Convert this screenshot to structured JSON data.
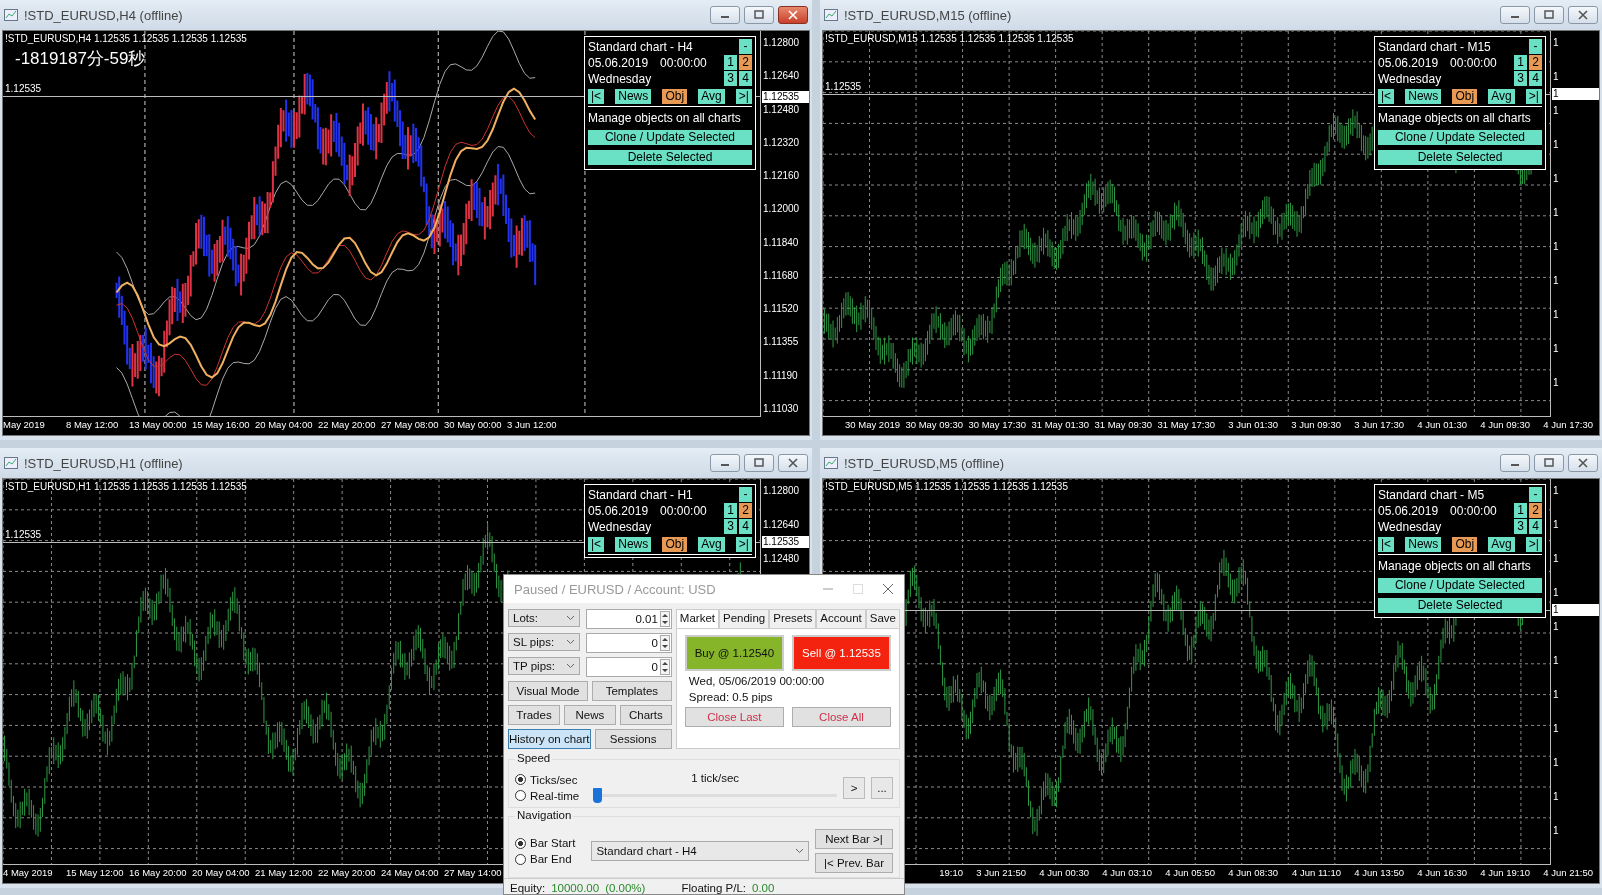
{
  "windows": [
    {
      "title": "!STD_EURUSD,H4 (offline)",
      "active": true,
      "kind": "candles",
      "symbol_line": "!STD_EURUSD,H4  1.12535 1.12535 1.12535 1.12535",
      "overlay_text": "-1819187分-59秒",
      "price_line_label": "1.12535",
      "y_axis_labels": [
        {
          "text": "1.12800",
          "current": false
        },
        {
          "text": "1.12640",
          "current": false
        },
        {
          "text": "1.12535",
          "current": true
        },
        {
          "text": "1.12480",
          "current": false
        },
        {
          "text": "1.12320",
          "current": false
        },
        {
          "text": "1.12160",
          "current": false
        },
        {
          "text": "1.12000",
          "current": false
        },
        {
          "text": "1.11840",
          "current": false
        },
        {
          "text": "1.11680",
          "current": false
        },
        {
          "text": "1.11520",
          "current": false
        },
        {
          "text": "1.11355",
          "current": false
        },
        {
          "text": "1.11190",
          "current": false
        },
        {
          "text": "1.11030",
          "current": false
        }
      ],
      "x_axis_labels": [
        "May 2019",
        "8 May 12:00",
        "13 May 00:00",
        "15 May 16:00",
        "20 May 04:00",
        "22 May 20:00",
        "27 May 08:00",
        "30 May 00:00",
        "3 Jun 12:00"
      ],
      "panel": {
        "title": "Standard chart - H4",
        "date": "05.06.2019",
        "time": "00:00:00",
        "weekday": "Wednesday",
        "collapse": "-",
        "numbers": [
          {
            "label": "1",
            "selected": false
          },
          {
            "label": "2",
            "selected": true
          },
          {
            "label": "3",
            "selected": false
          },
          {
            "label": "4",
            "selected": false
          }
        ],
        "nav": [
          {
            "label": "|<",
            "selected": false
          },
          {
            "label": "News",
            "selected": false
          },
          {
            "label": "Obj",
            "selected": true
          },
          {
            "label": "Avg",
            "selected": false
          },
          {
            "label": ">|",
            "selected": false
          }
        ],
        "manage_title": "Manage objects on all charts",
        "actions": [
          "Clone / Update Selected",
          "Delete Selected"
        ]
      }
    },
    {
      "title": "!STD_EURUSD,M15 (offline)",
      "active": false,
      "kind": "bars",
      "symbol_line": "!STD_EURUSD,M15  1.12535 1.12535 1.12535 1.12535",
      "price_line_label": "1.12535",
      "y_axis_labels": [
        {
          "text": "1",
          "current": false
        },
        {
          "text": "1",
          "current": false
        },
        {
          "text": "1",
          "current": true
        },
        {
          "text": "1",
          "current": false
        },
        {
          "text": "1",
          "current": false
        },
        {
          "text": "1",
          "current": false
        },
        {
          "text": "1",
          "current": false
        },
        {
          "text": "1",
          "current": false
        },
        {
          "text": "1",
          "current": false
        },
        {
          "text": "1",
          "current": false
        },
        {
          "text": "1",
          "current": false
        },
        {
          "text": "1",
          "current": false
        }
      ],
      "x_axis_labels": [
        "30 May 2019",
        "30 May 09:30",
        "30 May 17:30",
        "31 May 01:30",
        "31 May 09:30",
        "31 May 17:30",
        "3 Jun 01:30",
        "3 Jun 09:30",
        "3 Jun 17:30",
        "4 Jun 01:30",
        "4 Jun 09:30",
        "4 Jun 17:30"
      ],
      "panel": {
        "title": "Standard chart - M15",
        "date": "05.06.2019",
        "time": "00:00:00",
        "weekday": "Wednesday",
        "collapse": "-",
        "numbers": [
          {
            "label": "1",
            "selected": false
          },
          {
            "label": "2",
            "selected": true
          },
          {
            "label": "3",
            "selected": false
          },
          {
            "label": "4",
            "selected": false
          }
        ],
        "nav": [
          {
            "label": "|<",
            "selected": false
          },
          {
            "label": "News",
            "selected": false
          },
          {
            "label": "Obj",
            "selected": true
          },
          {
            "label": "Avg",
            "selected": false
          },
          {
            "label": ">|",
            "selected": false
          }
        ],
        "manage_title": "Manage objects on all charts",
        "actions": [
          "Clone / Update Selected",
          "Delete Selected"
        ]
      }
    },
    {
      "title": "!STD_EURUSD,H1 (offline)",
      "active": false,
      "kind": "bars",
      "symbol_line": "!STD_EURUSD,H1  1.12535 1.12535 1.12535 1.12535",
      "price_line_label": "1.12535",
      "y_axis_labels": [
        {
          "text": "1.12800",
          "current": false
        },
        {
          "text": "1.12640",
          "current": false
        },
        {
          "text": "1.12535",
          "current": true
        },
        {
          "text": "1.12480",
          "current": false
        }
      ],
      "x_axis_labels": [
        "4 May 2019",
        "15 May 12:00",
        "16 May 20:00",
        "20 May 04:00",
        "21 May 12:00",
        "22 May 20:00",
        "24 May 04:00",
        "27 May 14:00"
      ],
      "panel": {
        "title": "Standard chart - H1",
        "date": "05.06.2019",
        "time": "00:00:00",
        "weekday": "Wednesday",
        "collapse": "-",
        "numbers": [
          {
            "label": "1",
            "selected": false
          },
          {
            "label": "2",
            "selected": true
          },
          {
            "label": "3",
            "selected": false
          },
          {
            "label": "4",
            "selected": false
          }
        ],
        "nav": [
          {
            "label": "|<",
            "selected": false
          },
          {
            "label": "News",
            "selected": false
          },
          {
            "label": "Obj",
            "selected": true
          },
          {
            "label": "Avg",
            "selected": false
          },
          {
            "label": ">|",
            "selected": false
          }
        ]
      }
    },
    {
      "title": "!STD_EURUSD,M5 (offline)",
      "active": false,
      "kind": "bars",
      "symbol_line": "!STD_EURUSD,M5  1.12535 1.12535 1.12535 1.12535",
      "y_axis_labels": [
        {
          "text": "1",
          "current": false
        },
        {
          "text": "1",
          "current": false
        },
        {
          "text": "1",
          "current": false
        },
        {
          "text": "1",
          "current": false
        },
        {
          "text": "1",
          "current": true
        },
        {
          "text": "1",
          "current": false
        },
        {
          "text": "1",
          "current": false
        },
        {
          "text": "1",
          "current": false
        },
        {
          "text": "1",
          "current": false
        },
        {
          "text": "1",
          "current": false
        },
        {
          "text": "1",
          "current": false
        },
        {
          "text": "1",
          "current": false
        }
      ],
      "x_axis_labels": [
        "19:10",
        "3 Jun 21:50",
        "4 Jun 00:30",
        "4 Jun 03:10",
        "4 Jun 05:50",
        "4 Jun 08:30",
        "4 Jun 11:10",
        "4 Jun 13:50",
        "4 Jun 16:30",
        "4 Jun 19:10",
        "4 Jun 21:50"
      ],
      "panel": {
        "title": "Standard chart - M5",
        "date": "05.06.2019",
        "time": "00:00:00",
        "weekday": "Wednesday",
        "collapse": "-",
        "numbers": [
          {
            "label": "1",
            "selected": false
          },
          {
            "label": "2",
            "selected": true
          },
          {
            "label": "3",
            "selected": false
          },
          {
            "label": "4",
            "selected": false
          }
        ],
        "nav": [
          {
            "label": "|<",
            "selected": false
          },
          {
            "label": "News",
            "selected": false
          },
          {
            "label": "Obj",
            "selected": true
          },
          {
            "label": "Avg",
            "selected": false
          },
          {
            "label": ">|",
            "selected": false
          }
        ],
        "manage_title": "Manage objects on all charts",
        "actions": [
          "Clone / Update Selected",
          "Delete Selected"
        ]
      }
    }
  ],
  "dialog": {
    "title": "Paused / EURUSD / Account: USD",
    "params": [
      {
        "label": "Lots:",
        "value": "0.01"
      },
      {
        "label": "SL pips:",
        "value": "0"
      },
      {
        "label": "TP pips:",
        "value": "0"
      }
    ],
    "button_rows": [
      [
        {
          "label": "Visual Mode",
          "selected": false
        },
        {
          "label": "Templates",
          "selected": false
        }
      ],
      [
        {
          "label": "Trades",
          "selected": false
        },
        {
          "label": "News",
          "selected": false
        },
        {
          "label": "Charts",
          "selected": false
        }
      ],
      [
        {
          "label": "History on chart",
          "selected": true
        },
        {
          "label": "Sessions",
          "selected": false
        }
      ]
    ],
    "tabs": [
      {
        "label": "Market",
        "selected": true
      },
      {
        "label": "Pending",
        "selected": false
      },
      {
        "label": "Presets",
        "selected": false
      },
      {
        "label": "Account",
        "selected": false
      },
      {
        "label": "Save",
        "selected": false
      }
    ],
    "buy": "Buy @ 1.12540",
    "sell": "Sell @ 1.12535",
    "datetime": "Wed, 05/06/2019  00:00:00",
    "spread": "Spread: 0.5 pips",
    "close_buttons": [
      "Close Last",
      "Close All"
    ],
    "speed": {
      "legend": "Speed",
      "options": [
        {
          "label": "Ticks/sec",
          "selected": true
        },
        {
          "label": "Real-time",
          "selected": false
        }
      ],
      "reading": "1 tick/sec",
      "level": 0,
      "buttons": [
        ">",
        "..."
      ]
    },
    "navigation": {
      "legend": "Navigation",
      "options": [
        {
          "label": "Bar Start",
          "selected": true
        },
        {
          "label": "Bar End",
          "selected": false
        }
      ],
      "chart_select": "Standard chart - H4",
      "buttons": [
        "Next Bar >|",
        "|< Prev. Bar"
      ]
    },
    "status": {
      "equity_label": "Equity:",
      "equity": "10000.00",
      "equity_pct": "(0.00%)",
      "pl_label": "Floating P/L:",
      "pl": "0.00"
    }
  }
}
